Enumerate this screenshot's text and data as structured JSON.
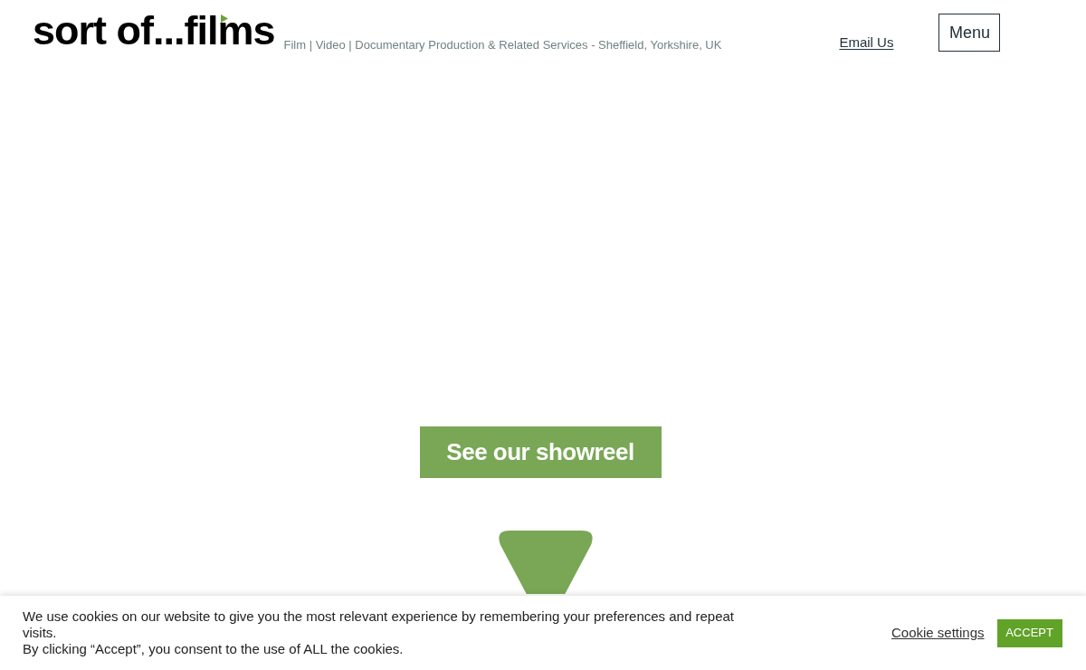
{
  "header": {
    "logo": "sort of...films",
    "tagline": "Film | Video | Documentary Production & Related Services - Sheffield, Yorkshire, UK",
    "email_link": "Email Us",
    "menu_button": "Menu"
  },
  "hero": {
    "showreel_button": "See our showreel"
  },
  "cookie_banner": {
    "message_lines": [
      "We use cookies on our website to give you the most relevant experience by remembering your preferences and repeat visits.",
      "By clicking “Accept”, you consent to the use of ALL the cookies."
    ],
    "settings_link": "Cookie settings",
    "accept_button": "ACCEPT"
  }
}
